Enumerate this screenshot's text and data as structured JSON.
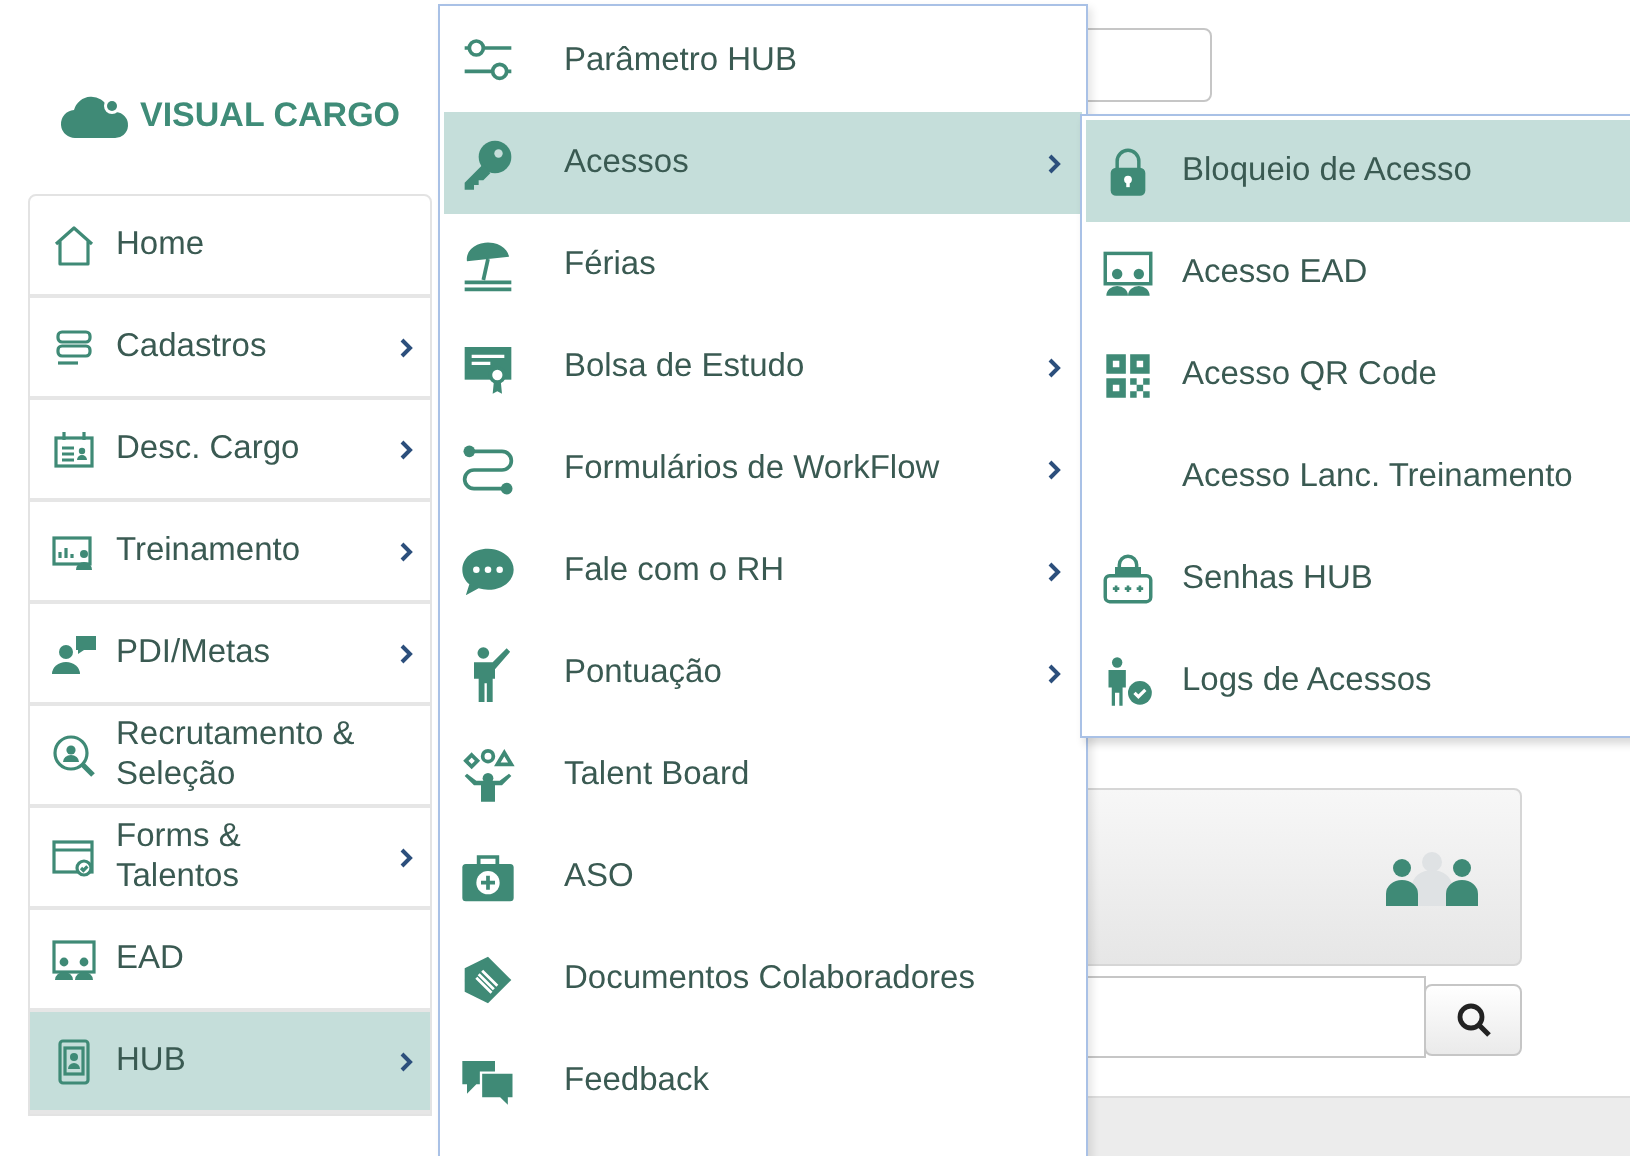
{
  "logo": {
    "text": "VISUAL CARGO"
  },
  "sidebar": {
    "items": [
      {
        "label": "Home",
        "has_submenu": false,
        "selected": false
      },
      {
        "label": "Cadastros",
        "has_submenu": true,
        "selected": false
      },
      {
        "label": "Desc. Cargo",
        "has_submenu": true,
        "selected": false
      },
      {
        "label": "Treinamento",
        "has_submenu": true,
        "selected": false
      },
      {
        "label": "PDI/Metas",
        "has_submenu": true,
        "selected": false
      },
      {
        "label": "Recrutamento & Seleção",
        "has_submenu": false,
        "selected": false
      },
      {
        "label": "Forms & Talentos",
        "has_submenu": true,
        "selected": false
      },
      {
        "label": "EAD",
        "has_submenu": false,
        "selected": false
      },
      {
        "label": "HUB",
        "has_submenu": true,
        "selected": true
      }
    ]
  },
  "menu": {
    "items": [
      {
        "label": "Parâmetro HUB",
        "has_submenu": false,
        "selected": false
      },
      {
        "label": "Acessos",
        "has_submenu": true,
        "selected": true
      },
      {
        "label": "Férias",
        "has_submenu": false,
        "selected": false
      },
      {
        "label": "Bolsa de Estudo",
        "has_submenu": true,
        "selected": false
      },
      {
        "label": "Formulários de WorkFlow",
        "has_submenu": true,
        "selected": false
      },
      {
        "label": "Fale com o RH",
        "has_submenu": true,
        "selected": false
      },
      {
        "label": "Pontuação",
        "has_submenu": true,
        "selected": false
      },
      {
        "label": "Talent Board",
        "has_submenu": false,
        "selected": false
      },
      {
        "label": "ASO",
        "has_submenu": false,
        "selected": false
      },
      {
        "label": "Documentos Colaboradores",
        "has_submenu": false,
        "selected": false
      },
      {
        "label": "Feedback",
        "has_submenu": false,
        "selected": false
      }
    ]
  },
  "submenu": {
    "items": [
      {
        "label": "Bloqueio de Acesso",
        "selected": true
      },
      {
        "label": "Acesso EAD",
        "selected": false
      },
      {
        "label": "Acesso QR Code",
        "selected": false
      },
      {
        "label": "Acesso Lanc. Treinamento",
        "selected": false
      },
      {
        "label": "Senhas HUB",
        "selected": false
      },
      {
        "label": "Logs de Acessos",
        "selected": false
      }
    ]
  }
}
